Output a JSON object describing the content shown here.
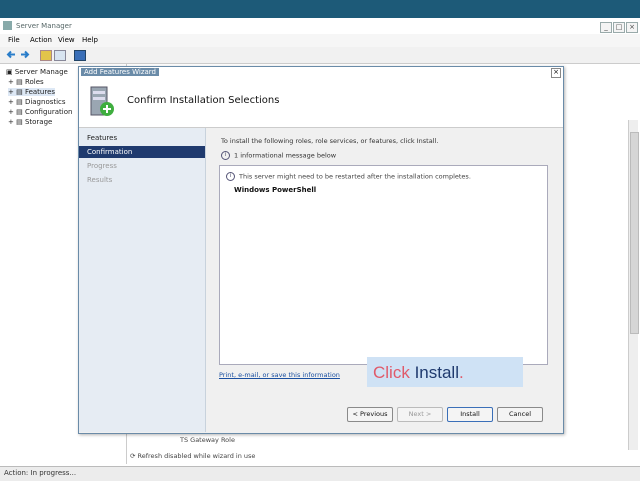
{
  "window": {
    "title": "Server Manager",
    "min": "_",
    "max": "□",
    "close": "×"
  },
  "menu": [
    "File",
    "Action",
    "View",
    "Help"
  ],
  "tree": {
    "root": "Server Manage",
    "items": [
      "Roles",
      "Features",
      "Diagnostics",
      "Configuration",
      "Storage"
    ]
  },
  "wizard": {
    "title": "Add Features Wizard",
    "heading": "Confirm Installation Selections",
    "close": "×",
    "steps": [
      "Features",
      "Confirmation",
      "Progress",
      "Results"
    ],
    "active_step": 1,
    "intro": "To install the following roles, role services, or features, click Install.",
    "info_count": "1 informational message below",
    "list_message": "This server might need to be restarted after the installation completes.",
    "feature": "Windows PowerShell",
    "link": "Print, e-mail, or save this information",
    "buttons": {
      "previous": "< Previous",
      "next": "Next >",
      "install": "Install",
      "cancel": "Cancel"
    }
  },
  "callout": {
    "prefix": "Click ",
    "keyword": "Install",
    "suffix": ".",
    "prefix_color": "#e05a6a",
    "keyword_color": "#1f3a6e"
  },
  "background": {
    "line1": "TS Gateway  Role",
    "line2": "Refresh disabled while wizard in use"
  },
  "status": "Action: In progress..."
}
